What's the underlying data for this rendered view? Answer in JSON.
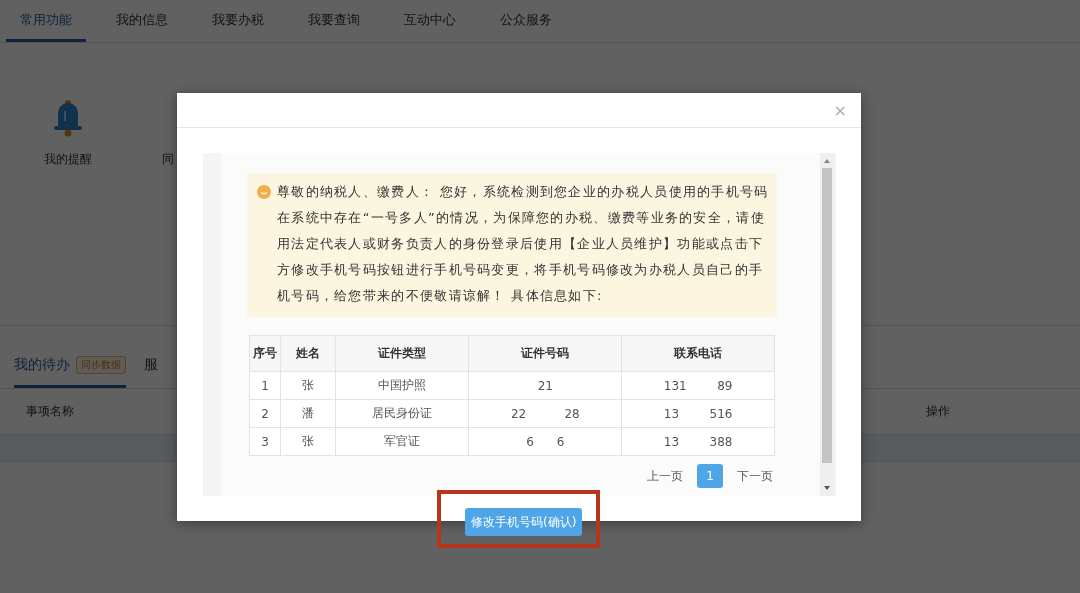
{
  "tabs": [
    {
      "label": "常用功能",
      "selected": true
    },
    {
      "label": "我的信息",
      "selected": false
    },
    {
      "label": "我要办税",
      "selected": false
    },
    {
      "label": "我要查询",
      "selected": false
    },
    {
      "label": "互动中心",
      "selected": false
    },
    {
      "label": "公众服务",
      "selected": false
    }
  ],
  "shortcuts": [
    {
      "label": "我的提醒",
      "kind": "bell"
    },
    {
      "label": "同",
      "kind": "blank"
    }
  ],
  "todo_tabs": [
    {
      "label": "我的待办",
      "badge": "同步数据",
      "selected": true
    },
    {
      "label": "服",
      "selected": false
    }
  ],
  "todo_table": {
    "columns": [
      "事项名称",
      "操作"
    ]
  },
  "dialog": {
    "close": "×",
    "notice": "尊敬的纳税人、缴费人： 您好，系统检测到您企业的办税人员使用的手机号码在系统中存在“一号多人”的情况，为保障您的办税、缴费等业务的安全，请使用法定代表人或财务负责人的身份登录后使用【企业人员维护】功能或点击下方修改手机号码按钮进行手机号码变更，将手机号码修改为办税人员自己的手机号码，给您带来的不便敬请谅解！ 具体信息如下:",
    "table": {
      "columns": [
        "序号",
        "姓名",
        "证件类型",
        "证件号码",
        "联系电话"
      ],
      "rows": [
        [
          "1",
          "张",
          "中国护照",
          "21",
          "131        89"
        ],
        [
          "2",
          "潘",
          "居民身份证",
          "22          28",
          "13        516"
        ],
        [
          "3",
          "张",
          "军官证",
          "6      6",
          "13        388"
        ]
      ]
    },
    "pagination": {
      "prev": "上一页",
      "pages": [
        {
          "label": "1",
          "selected": true
        }
      ],
      "next": "下一页"
    },
    "confirm_button": "修改手机号码(确认)",
    "highlighted": true
  }
}
